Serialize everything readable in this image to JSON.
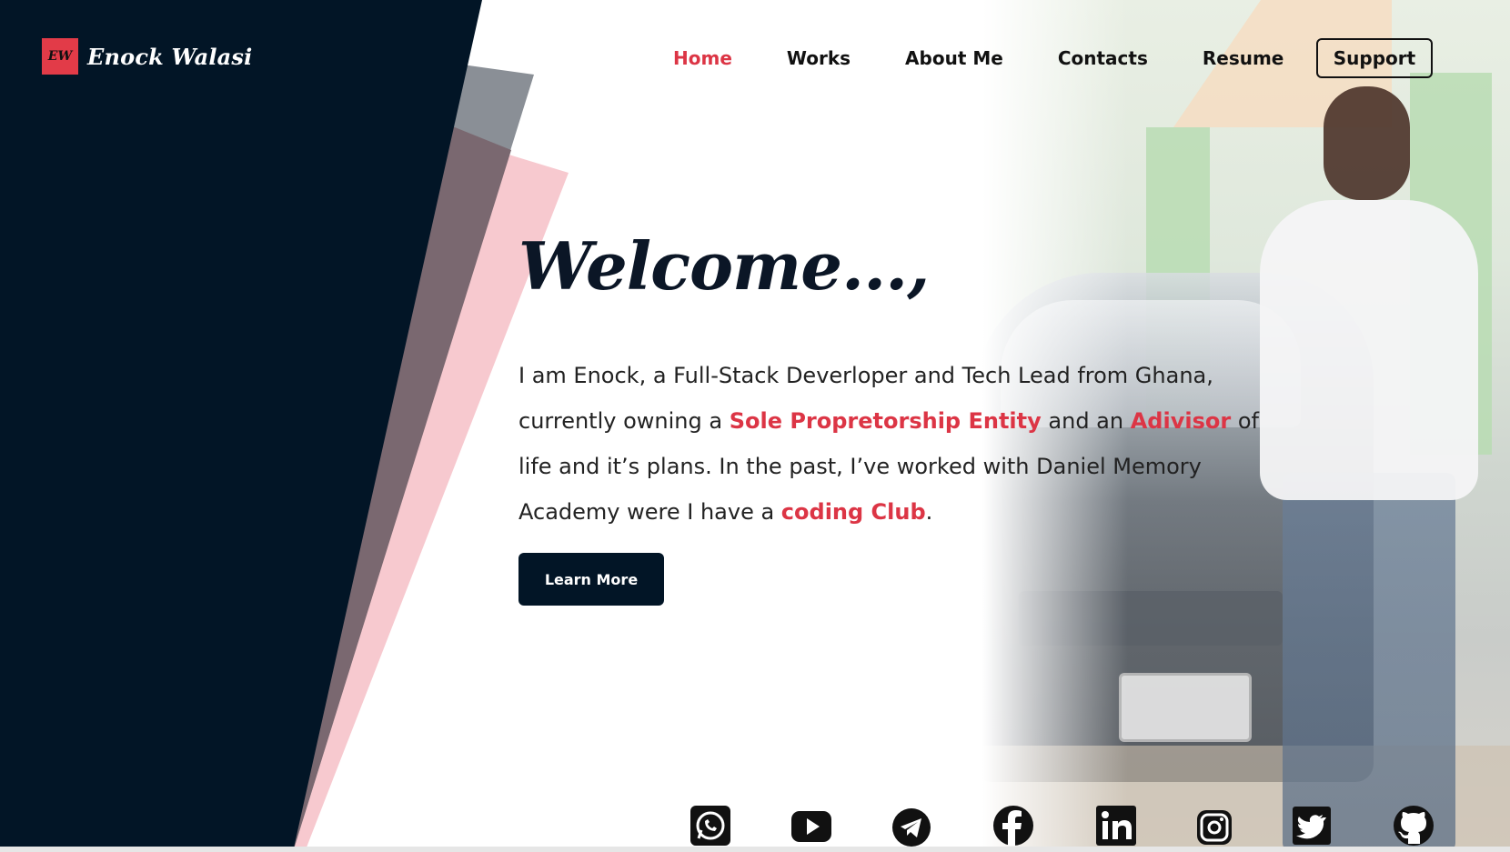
{
  "brand": {
    "logo_mark": "EW",
    "name": "Enock Walasi"
  },
  "nav": {
    "items": [
      {
        "label": "Home",
        "active": true
      },
      {
        "label": "Works",
        "active": false
      },
      {
        "label": "About Me",
        "active": false
      },
      {
        "label": "Contacts",
        "active": false
      },
      {
        "label": "Resume",
        "active": false
      }
    ],
    "support_label": "Support"
  },
  "hero": {
    "title": "Welcome...,",
    "text_1": "I am Enock, a Full-Stack Deverloper and Tech Lead from Ghana, currently owning a ",
    "highlight_1": "Sole Propretorship Entity",
    "text_2": " and an ",
    "highlight_2": "Adivisor",
    "text_3": " of life and it’s plans. In the past, I’ve worked with Daniel Memory Academy were I have a ",
    "highlight_3": "coding Club",
    "text_4": ".",
    "cta_label": "Learn More"
  },
  "socials": [
    "whatsapp-icon",
    "youtube-icon",
    "telegram-icon",
    "facebook-icon",
    "linkedin-icon",
    "instagram-icon",
    "twitter-icon",
    "github-icon"
  ],
  "colors": {
    "accent": "#dc3545",
    "dark": "#021526",
    "pink_strip": "#f7c9cf",
    "grey_strip": "#8a8f96"
  }
}
